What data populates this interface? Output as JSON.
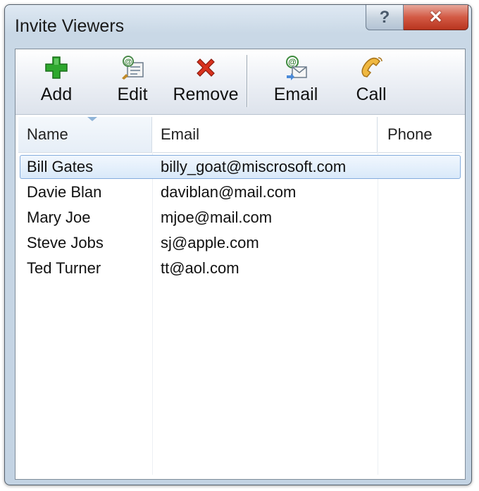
{
  "window": {
    "title": "Invite Viewers",
    "help_glyph": "?",
    "close_glyph": "✕"
  },
  "toolbar": {
    "buttons": [
      {
        "label": "Add",
        "icon": "green-plus-icon"
      },
      {
        "label": "Edit",
        "icon": "edit-contact-icon"
      },
      {
        "label": "Remove",
        "icon": "red-x-icon"
      },
      {
        "label": "Email",
        "icon": "email-icon"
      },
      {
        "label": "Call",
        "icon": "phone-icon"
      }
    ]
  },
  "list": {
    "columns": [
      "Name",
      "Email",
      "Phone"
    ],
    "sorted_by": "Name",
    "rows": [
      {
        "name": "Bill Gates",
        "email": "billy_goat@miscrosoft.com",
        "phone": "",
        "selected": true
      },
      {
        "name": "Davie Blan",
        "email": "daviblan@mail.com",
        "phone": "",
        "selected": false
      },
      {
        "name": "Mary Joe",
        "email": "mjoe@mail.com",
        "phone": "",
        "selected": false
      },
      {
        "name": "Steve Jobs",
        "email": "sj@apple.com",
        "phone": "",
        "selected": false
      },
      {
        "name": "Ted Turner",
        "email": "tt@aol.com",
        "phone": "",
        "selected": false
      }
    ]
  },
  "colors": {
    "close_button": "#c8442e",
    "selection_border": "#84acdd",
    "add_icon": "#2ea82e",
    "remove_icon": "#d8321e"
  }
}
